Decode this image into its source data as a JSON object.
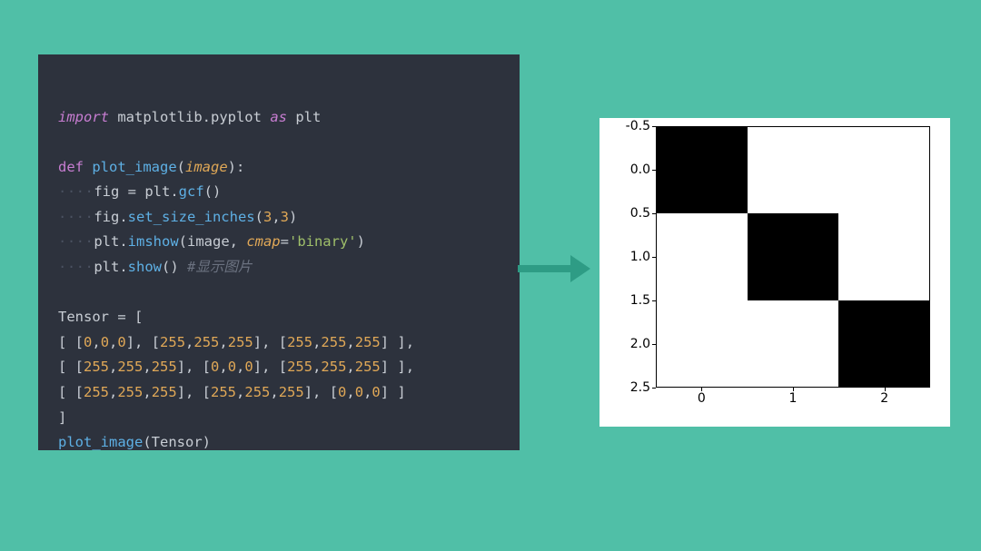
{
  "code": {
    "line1_import": "import",
    "line1_module": " matplotlib.pyplot ",
    "line1_as": "as",
    "line1_alias": " plt",
    "line3_def": "def",
    "line3_fn": " plot_image",
    "line3_open": "(",
    "line3_param": "image",
    "line3_close": "):",
    "line4_indent": "····",
    "line4_var": "fig = plt.",
    "line4_call": "gcf",
    "line4_after": "()",
    "line5_indent": "····",
    "line5_pre": "fig.",
    "line5_call": "set_size_inches",
    "line5_open": "(",
    "line5_a": "3",
    "line5_comma": ",",
    "line5_b": "3",
    "line5_close": ")",
    "line6_indent": "····",
    "line6_pre": "plt.",
    "line6_call": "imshow",
    "line6_open": "(image, ",
    "line6_kw": "cmap",
    "line6_eq": "=",
    "line6_str": "'binary'",
    "line6_close": ")",
    "line7_indent": "····",
    "line7_pre": "plt.",
    "line7_call": "show",
    "line7_after": "() ",
    "line7_comment": "#显示图片",
    "line9": "Tensor = [",
    "line10_open": "[ [",
    "line10_n1": "0",
    "line10_c": ",",
    "line10_n2": "0",
    "line10_n3": "0",
    "line10_mid1": "], [",
    "line10_n4": "255",
    "line10_n5": "255",
    "line10_n6": "255",
    "line10_mid2": "], [",
    "line10_n7": "255",
    "line10_n8": "255",
    "line10_n9": "255",
    "line10_close": "] ],",
    "line11_open": "[ [",
    "line11_n1": "255",
    "line11_n2": "255",
    "line11_n3": "255",
    "line11_mid1": "], [",
    "line11_n4": "0",
    "line11_n5": "0",
    "line11_n6": "0",
    "line11_mid2": "], [",
    "line11_n7": "255",
    "line11_n8": "255",
    "line11_n9": "255",
    "line11_close": "] ],",
    "line12_open": "[ [",
    "line12_n1": "255",
    "line12_n2": "255",
    "line12_n3": "255",
    "line12_mid1": "], [",
    "line12_n4": "255",
    "line12_n5": "255",
    "line12_n6": "255",
    "line12_mid2": "], [",
    "line12_n7": "0",
    "line12_n8": "0",
    "line12_n9": "0",
    "line12_close": "] ]",
    "line13": "]",
    "line14_fn": "plot_image",
    "line14_call": "(Tensor)"
  },
  "chart_data": {
    "type": "heatmap",
    "title": "",
    "xlabel": "",
    "ylabel": "",
    "x_ticks": [
      0,
      1,
      2
    ],
    "y_ticks": [
      -0.5,
      0.0,
      0.5,
      1.0,
      1.5,
      2.0,
      2.5
    ],
    "y_tick_labels": [
      "-0.5",
      "0.0",
      "0.5",
      "1.0",
      "1.5",
      "2.0",
      "2.5"
    ],
    "x_tick_labels": [
      "0",
      "1",
      "2"
    ],
    "xlim": [
      -0.5,
      2.5
    ],
    "ylim": [
      2.5,
      -0.5
    ],
    "cmap": "binary",
    "grid": [
      [
        [
          0,
          0,
          0
        ],
        [
          255,
          255,
          255
        ],
        [
          255,
          255,
          255
        ]
      ],
      [
        [
          255,
          255,
          255
        ],
        [
          0,
          0,
          0
        ],
        [
          255,
          255,
          255
        ]
      ],
      [
        [
          255,
          255,
          255
        ],
        [
          255,
          255,
          255
        ],
        [
          0,
          0,
          0
        ]
      ]
    ],
    "cell_colors": [
      [
        "black",
        "white",
        "white"
      ],
      [
        "white",
        "black",
        "white"
      ],
      [
        "white",
        "white",
        "black"
      ]
    ]
  }
}
